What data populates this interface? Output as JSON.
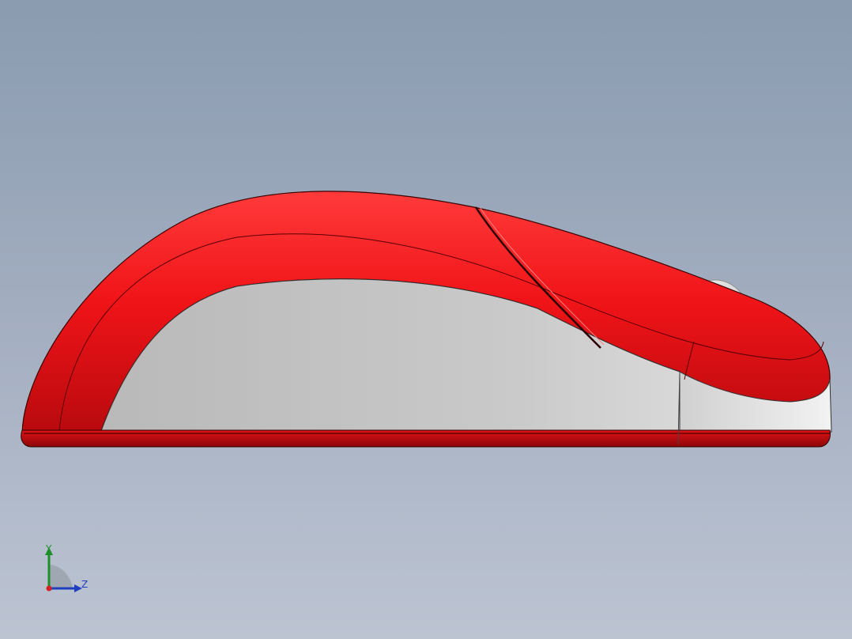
{
  "viewport": {
    "background_top": "#8a9bb0",
    "background_bottom": "#bcc4d2"
  },
  "model": {
    "shell_color": "#e8141a",
    "side_panel_color": "#c4c4c4",
    "wheel_color": "#e2e2e2"
  },
  "triad": {
    "y_label": "Y",
    "z_label": "Z",
    "y_color": "#1f8f2a",
    "z_color": "#1f3fbf",
    "origin_color": "#d42020"
  }
}
